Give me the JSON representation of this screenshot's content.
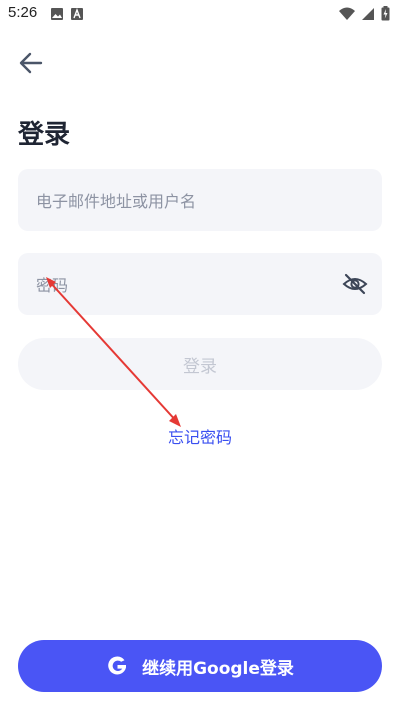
{
  "status_bar": {
    "time": "5:26",
    "icons": [
      "image-icon",
      "font-icon",
      "wifi-icon",
      "signal-icon",
      "battery-charging-icon"
    ]
  },
  "header": {
    "back_icon": "arrow-left-icon",
    "title": "登录"
  },
  "form": {
    "email_placeholder": "电子邮件地址或用户名",
    "email_value": "",
    "password_placeholder": "密码",
    "password_value": "",
    "password_toggle_icon": "eye-off-icon",
    "login_label": "登录",
    "forgot_label": "忘记密码"
  },
  "google": {
    "icon": "google-g-icon",
    "label": "继续用Google登录"
  },
  "colors": {
    "accent": "#4a55f5",
    "link": "#3a4ff0",
    "field_bg": "#f4f5f9",
    "annotation_arrow": "#e53935"
  }
}
